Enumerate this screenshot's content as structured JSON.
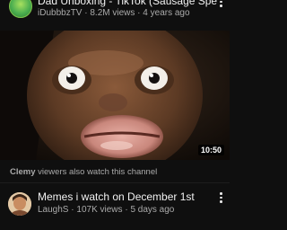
{
  "top_video": {
    "title": "Dad Unboxing - TikTok (Sausage Special)",
    "channel": "iDubbbzTV",
    "views": "8.2M views",
    "age": "4 years ago",
    "separator": "·"
  },
  "featured_video": {
    "duration": "10:50"
  },
  "also_watch": {
    "channel": "Clemy",
    "text": "viewers also watch this channel"
  },
  "second_video": {
    "title": "Memes i watch on December 1st",
    "channel": "LaughS",
    "views": "107K views",
    "age": "5 days ago",
    "separator": "·"
  },
  "colors": {
    "background": "#0f0f0f",
    "secondary_text": "#aaaaaa",
    "primary_text": "#f1f1f1"
  },
  "icons": {
    "more": "kebab-menu-icon"
  }
}
